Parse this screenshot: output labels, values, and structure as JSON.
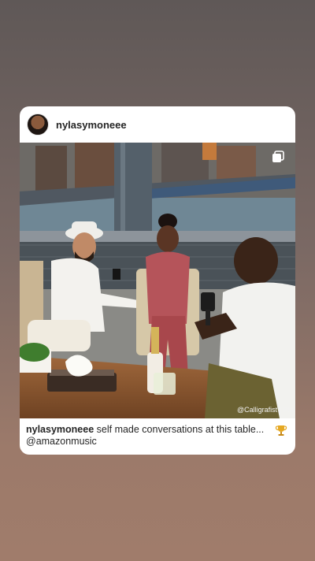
{
  "post": {
    "username": "nylasymoneee",
    "photo_credit": "@Calligrafist | Pho",
    "caption_user": "nylasymoneee",
    "caption_text": " self made conversations at this table...",
    "caption_line2": "@amazonmusic",
    "caption_icon": "trophy-icon",
    "multi_icon": "multiple-photos-icon"
  },
  "colors": {
    "background_top": "#5f5857",
    "background_bottom": "#a07c6b",
    "card": "#ffffff",
    "text": "#262626"
  }
}
